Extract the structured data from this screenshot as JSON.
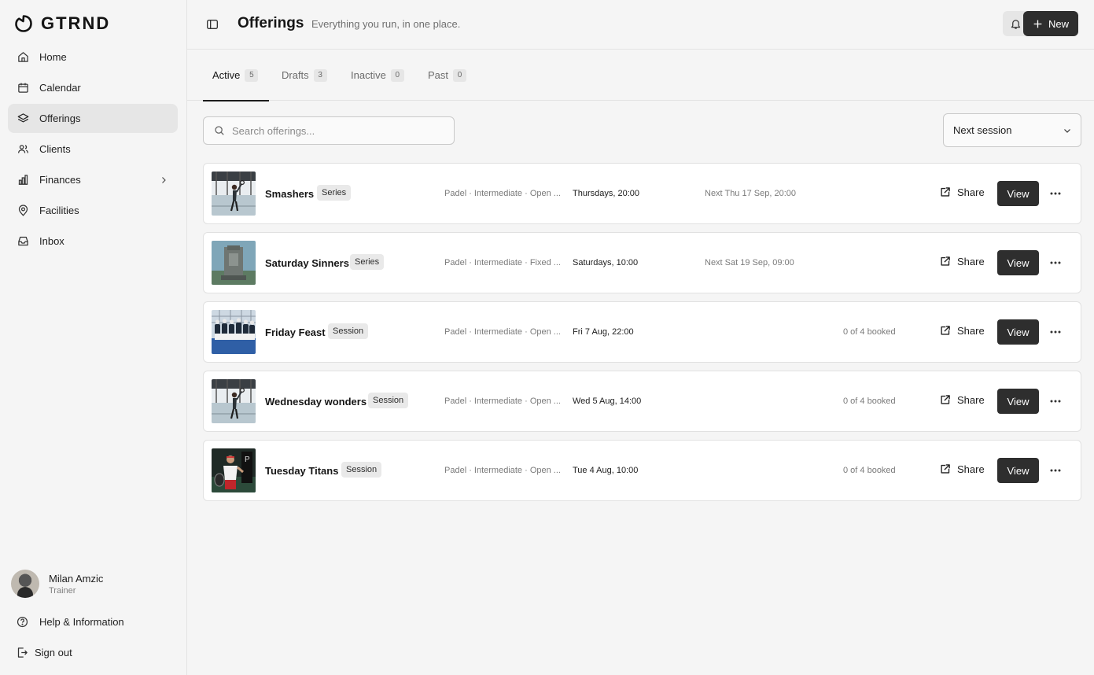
{
  "app": {
    "brand": "GTRND"
  },
  "sidebar": {
    "items": [
      {
        "label": "Home",
        "icon": "home-icon"
      },
      {
        "label": "Calendar",
        "icon": "calendar-icon"
      },
      {
        "label": "Offerings",
        "icon": "layers-icon",
        "active": true
      },
      {
        "label": "Clients",
        "icon": "users-icon"
      },
      {
        "label": "Finances",
        "icon": "bar-chart-icon",
        "has_submenu": true
      },
      {
        "label": "Facilities",
        "icon": "map-pin-icon"
      },
      {
        "label": "Inbox",
        "icon": "inbox-icon"
      }
    ],
    "profile": {
      "name": "Milan Amzic",
      "role": "Trainer"
    },
    "help_label": "Help & Information",
    "signout_label": "Sign out"
  },
  "header": {
    "title": "Offerings",
    "subtitle": "Everything you run, in one place.",
    "new_label": "New"
  },
  "tabs": [
    {
      "label": "Active",
      "count": "5",
      "active": true
    },
    {
      "label": "Drafts",
      "count": "3"
    },
    {
      "label": "Inactive",
      "count": "0"
    },
    {
      "label": "Past",
      "count": "0"
    }
  ],
  "toolbar": {
    "search_placeholder": "Search offerings...",
    "search_value": "",
    "sort_value": "Next session"
  },
  "offerings": [
    {
      "title": "Smashers",
      "type": "Series",
      "meta": "Padel · Intermediate · Open ...",
      "when": "Thursdays, 20:00",
      "next": "Next Thu 17 Sep, 20:00",
      "booked": "",
      "share_label": "Share",
      "view_label": "View",
      "thumb": "player-glass"
    },
    {
      "title": "Saturday Sinners",
      "type": "Series",
      "meta": "Padel · Intermediate · Fixed ...",
      "when": "Saturdays, 10:00",
      "next": "Next Sat 19 Sep, 09:00",
      "booked": "",
      "share_label": "Share",
      "view_label": "View",
      "thumb": "monument"
    },
    {
      "title": "Friday Feast",
      "type": "Session",
      "meta": "Padel · Intermediate · Open ...",
      "when": "Fri 7 Aug, 22:00",
      "next": "",
      "booked": "0 of 4 booked",
      "share_label": "Share",
      "view_label": "View",
      "thumb": "team"
    },
    {
      "title": "Wednesday wonders",
      "type": "Session",
      "meta": "Padel · Intermediate · Open ...",
      "when": "Wed 5 Aug, 14:00",
      "next": "",
      "booked": "0 of 4 booked",
      "share_label": "Share",
      "view_label": "View",
      "thumb": "player-glass"
    },
    {
      "title": "Tuesday Titans",
      "type": "Session",
      "meta": "Padel · Intermediate · Open ...",
      "when": "Tue 4 Aug, 10:00",
      "next": "",
      "booked": "0 of 4 booked",
      "share_label": "Share",
      "view_label": "View",
      "thumb": "player-dark"
    }
  ],
  "colors": {
    "primary_button": "#2e2e2e",
    "active_nav_bg": "#e6e6e6",
    "page_bg": "#f5f5f5"
  }
}
